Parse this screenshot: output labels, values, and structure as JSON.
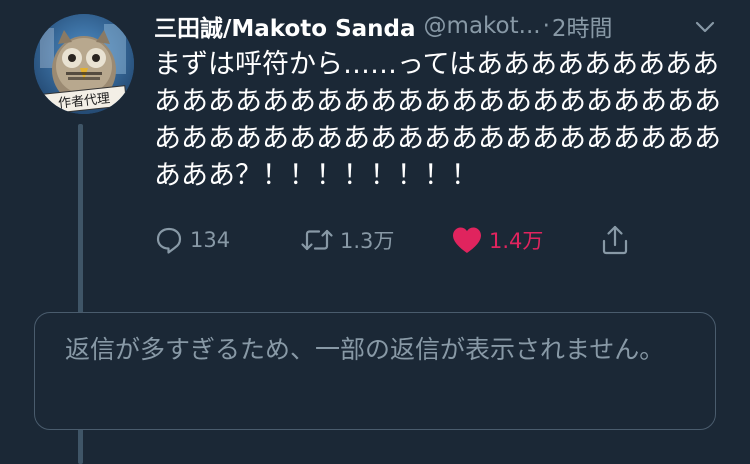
{
  "tweet": {
    "author_name": "三田誠/Makoto Sanda",
    "author_handle": "@makot...",
    "separator": "·",
    "time": "2時間",
    "avatar_caption": "作者代理",
    "text": "まずは呼符から……ってはああああああああああああああああああああああああああああああああああああああああああああああああああああああ？！！！！！！！！",
    "actions": {
      "reply_count": "134",
      "retweet_count": "1.3万",
      "like_count": "1.4万",
      "liked": true
    }
  },
  "notice": {
    "text": "返信が多すぎるため、一部の返信が表示されません。"
  },
  "colors": {
    "background": "#1b2836",
    "primary_text": "#ffffff",
    "secondary_text": "#8899a6",
    "like": "#e0245e",
    "thread_line": "#3f5567",
    "border": "#4a5c6d"
  },
  "icons": {
    "reply": "speech-bubble-icon",
    "retweet": "retweet-icon",
    "like": "heart-icon",
    "share": "share-icon",
    "menu": "chevron-down-icon"
  }
}
